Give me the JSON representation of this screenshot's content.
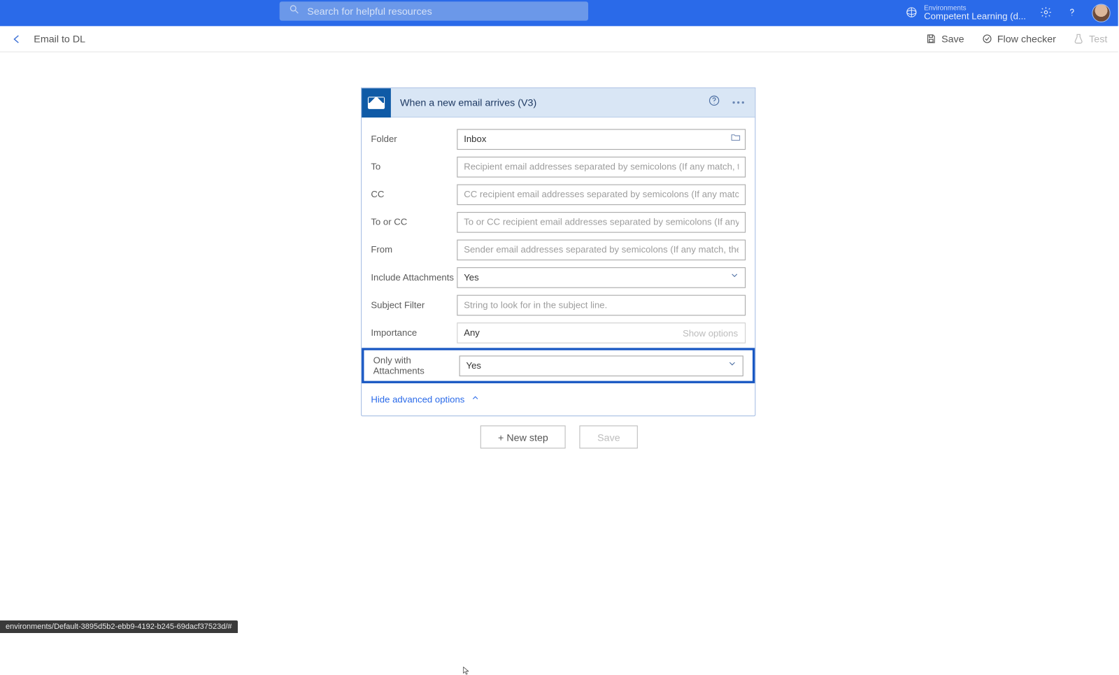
{
  "topbar": {
    "search_placeholder": "Search for helpful resources",
    "env_label": "Environments",
    "env_name": "Competent Learning (d..."
  },
  "cmdbar": {
    "flow_name": "Email to DL",
    "save": "Save",
    "flow_checker": "Flow checker",
    "test": "Test"
  },
  "trigger": {
    "title": "When a new email arrives (V3)",
    "fields": {
      "folder_label": "Folder",
      "folder_value": "Inbox",
      "to_label": "To",
      "to_placeholder": "Recipient email addresses separated by semicolons (If any match, the",
      "cc_label": "CC",
      "cc_placeholder": "CC recipient email addresses separated by semicolons (If any match,",
      "tocc_label": "To or CC",
      "tocc_placeholder": "To or CC recipient email addresses separated by semicolons (If any m",
      "from_label": "From",
      "from_placeholder": "Sender email addresses separated by semicolons (If any match, the t",
      "inc_att_label": "Include Attachments",
      "inc_att_value": "Yes",
      "subj_label": "Subject Filter",
      "subj_placeholder": "String to look for in the subject line.",
      "imp_label": "Importance",
      "imp_value": "Any",
      "show_options": "Show options",
      "only_att_label": "Only with Attachments",
      "only_att_value": "Yes"
    },
    "adv_toggle": "Hide advanced options"
  },
  "buttons": {
    "new_step": "+ New step",
    "save": "Save"
  },
  "status_url": "environments/Default-3895d5b2-ebb9-4192-b245-69dacf37523d/#"
}
